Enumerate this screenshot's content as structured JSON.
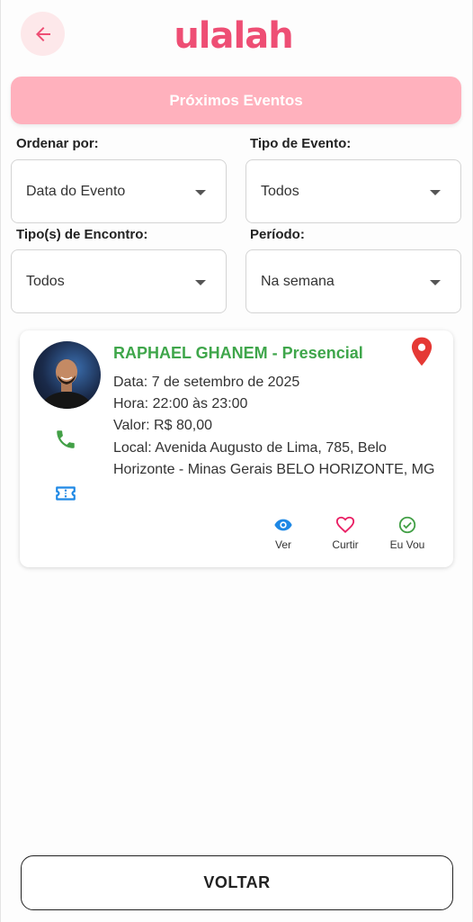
{
  "header": {
    "logo_text": "ulalah",
    "back_icon": "arrow-left-icon",
    "accent_color": "#ee4e74"
  },
  "title_bar": {
    "label": "Próximos Eventos",
    "color": "#ffb1bd"
  },
  "filters": {
    "ordenar": {
      "label": "Ordenar por:",
      "value": "Data do Evento"
    },
    "tipo_evento": {
      "label": "Tipo de Evento:",
      "value": "Todos"
    },
    "tipo_encontro": {
      "label": "Tipo(s) de Encontro:",
      "value": "Todos"
    },
    "periodo": {
      "label": "Período:",
      "value": "Na semana"
    }
  },
  "event": {
    "title": "RAPHAEL GHANEM - Presencial",
    "date": "Data: 7 de setembro de 2025",
    "time": "Hora: 22:00 às 23:00",
    "price": "Valor: R$ 80,00",
    "local": "Local: Avenida Augusto de Lima, 785, Belo Horizonte - Minas Gerais BELO HORIZONTE, MG",
    "title_color": "#3fa64b",
    "icons": [
      "location-pin-icon",
      "phone-icon",
      "ticket-icon"
    ],
    "actions": [
      {
        "label": "Ver",
        "icon": "eye-icon",
        "color": "#1e88e5"
      },
      {
        "label": "Curtir",
        "icon": "heart-icon",
        "color": "#e91e63"
      },
      {
        "label": "Eu Vou",
        "icon": "check-circle-icon",
        "color": "#43a047"
      }
    ]
  },
  "footer": {
    "voltar_label": "VOLTAR"
  }
}
